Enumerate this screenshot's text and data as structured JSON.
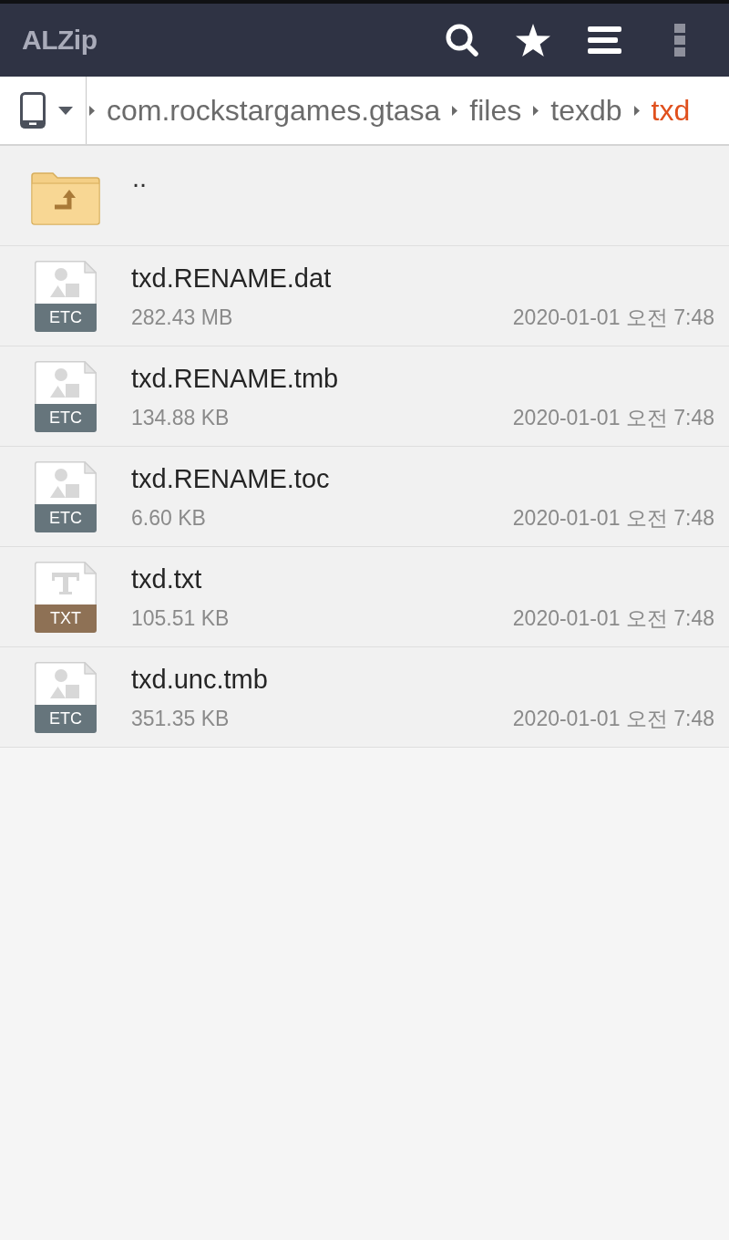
{
  "app_bar": {
    "title": "ALZip"
  },
  "breadcrumb": {
    "segments": [
      {
        "label": "com.rockstargames.gtasa",
        "selected": false
      },
      {
        "label": "files",
        "selected": false
      },
      {
        "label": "texdb",
        "selected": false
      },
      {
        "label": "txd",
        "selected": true
      }
    ]
  },
  "parent_row": {
    "label": ".."
  },
  "files": [
    {
      "kind": "etc",
      "type_label": "ETC",
      "name": "txd.RENAME.dat",
      "size": "282.43 MB",
      "modified": "2020-01-01 오전 7:48"
    },
    {
      "kind": "etc",
      "type_label": "ETC",
      "name": "txd.RENAME.tmb",
      "size": "134.88 KB",
      "modified": "2020-01-01 오전 7:48"
    },
    {
      "kind": "etc",
      "type_label": "ETC",
      "name": "txd.RENAME.toc",
      "size": "6.60 KB",
      "modified": "2020-01-01 오전 7:48"
    },
    {
      "kind": "txt",
      "type_label": "TXT",
      "name": "txd.txt",
      "size": "105.51 KB",
      "modified": "2020-01-01 오전 7:48"
    },
    {
      "kind": "etc",
      "type_label": "ETC",
      "name": "txd.unc.tmb",
      "size": "351.35 KB",
      "modified": "2020-01-01 오전 7:48"
    }
  ]
}
